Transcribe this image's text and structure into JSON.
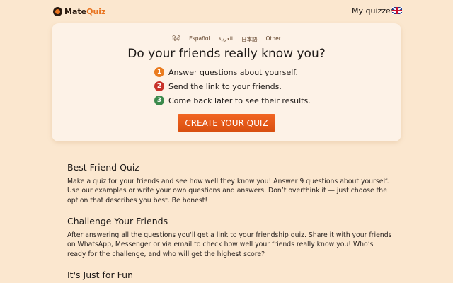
{
  "header": {
    "logo_mate": "Mate",
    "logo_quiz": "Quiz",
    "my_quizzes": "My quizzes"
  },
  "card": {
    "languages": [
      "हिंदी",
      "Español",
      "العربية",
      "日本語",
      "Other"
    ],
    "headline": "Do your friends really know you?",
    "steps": [
      {
        "num": "1",
        "text": "Answer questions about yourself.",
        "color": "#ea7b1f"
      },
      {
        "num": "2",
        "text": "Send the link to your friends.",
        "color": "#c8322a"
      },
      {
        "num": "3",
        "text": "Come back later to see their results.",
        "color": "#3b8a4c"
      }
    ],
    "cta": "CREATE YOUR QUIZ"
  },
  "sections": [
    {
      "title": "Best Friend Quiz",
      "body": "Make a quiz for your friends and see how well they know you! Answer 9 questions about yourself. Use our examples or write your own questions and answers. Don’t overthink it — just choose the option that describes you best. Be honest!"
    },
    {
      "title": "Challenge Your Friends",
      "body": "After answering all the questions you'll get a link to your friendship quiz. Share it with your friends on WhatsApp, Messenger or via email to check how well your friends really know you! Who’s ready for the challenge, and who will get the highest score?"
    },
    {
      "title": "It's Just for Fun",
      "body": ""
    }
  ],
  "colors": {
    "background": "#fbe7cf",
    "card": "#fdf2e7",
    "accent": "#e8731f"
  }
}
